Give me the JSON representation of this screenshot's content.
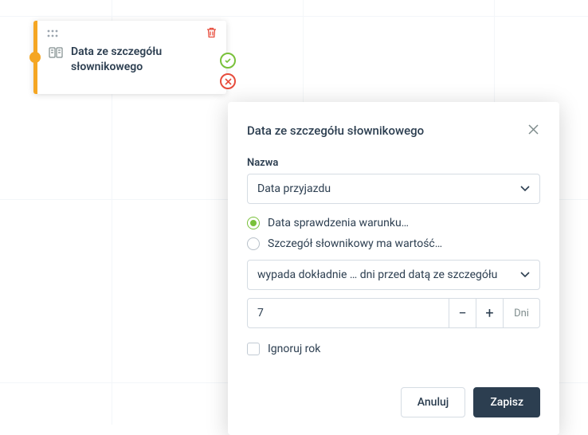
{
  "node": {
    "title": "Data ze szczegółu słownikowego"
  },
  "modal": {
    "title": "Data ze szczegółu słownikowego",
    "name_label": "Nazwa",
    "name_value": "Data przyjazdu",
    "radio": {
      "option1": "Data sprawdzenia warunku…",
      "option2": "Szczegół słownikowy ma wartość…",
      "selected": 0
    },
    "condition_select": "wypada dokładnie … dni przed datą ze szczegółu",
    "days_value": "7",
    "days_unit": "Dni",
    "ignore_year": "Ignoruj rok",
    "cancel": "Anuluj",
    "save": "Zapisz"
  }
}
